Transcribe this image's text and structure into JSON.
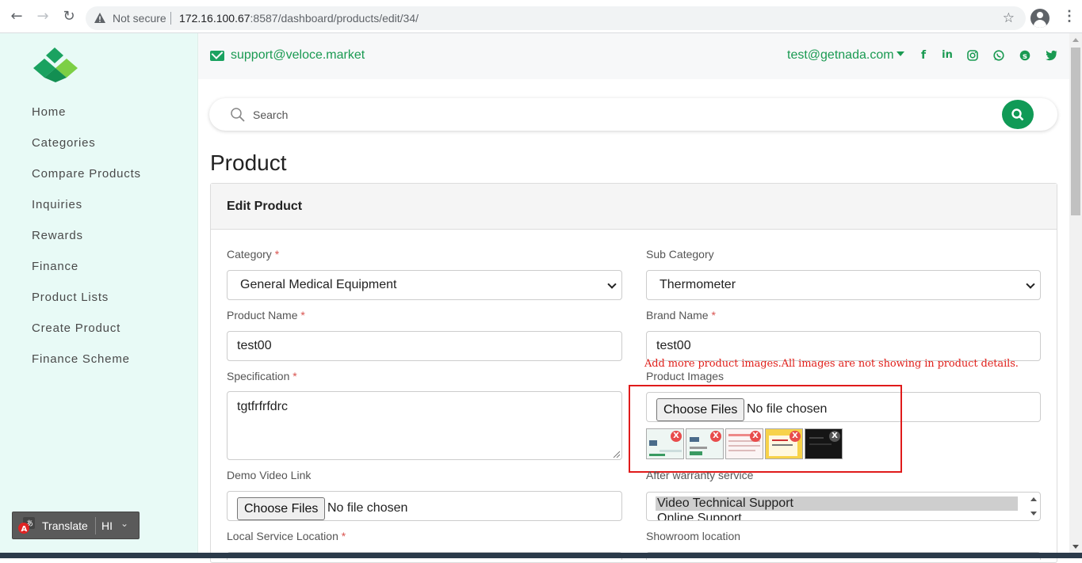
{
  "browser": {
    "security": "Not secure",
    "url_host": "172.16.100.67",
    "url_path": ":8587/dashboard/products/edit/34/"
  },
  "sidebar": {
    "items": [
      "Home",
      "Categories",
      "Compare Products",
      "Inquiries",
      "Rewards",
      "Finance",
      "Product Lists",
      "Create Product",
      "Finance Scheme"
    ]
  },
  "translate": {
    "label": "Translate",
    "lang": "HI"
  },
  "topbar": {
    "support_email": "support@veloce.market",
    "user_email": "test@getnada.com",
    "social_icons": [
      "facebook-icon",
      "linkedin-icon",
      "instagram-icon",
      "whatsapp-icon",
      "skype-icon",
      "twitter-icon"
    ]
  },
  "search": {
    "placeholder": "Search"
  },
  "page": {
    "title": "Product"
  },
  "form": {
    "header": "Edit Product",
    "category_label": "Category",
    "category_value": "General Medical Equipment",
    "subcategory_label": "Sub Category",
    "subcategory_value": "Thermometer",
    "product_name_label": "Product Name",
    "product_name_value": "test00",
    "brand_name_label": "Brand Name",
    "brand_name_value": "test00",
    "spec_label": "Specification",
    "spec_value": "tgtfrfrfdrc",
    "images_note": "Add more product images.All images are not showing in product details.",
    "images_label": "Product Images",
    "choose_files": "Choose Files",
    "no_file": "No file chosen",
    "remove_mark": "X",
    "demo_video_label": "Demo Video Link",
    "after_warranty_label": "After warranty service",
    "after_warranty_options": [
      "Video Technical Support",
      "Online Support"
    ],
    "local_service_label": "Local Service Location",
    "showroom_label": "Showroom location",
    "required_mark": "*"
  },
  "colors": {
    "brand_green": "#1a9a52",
    "sidebar_bg": "#e8faf6",
    "highlight_red": "#e01b1b"
  }
}
